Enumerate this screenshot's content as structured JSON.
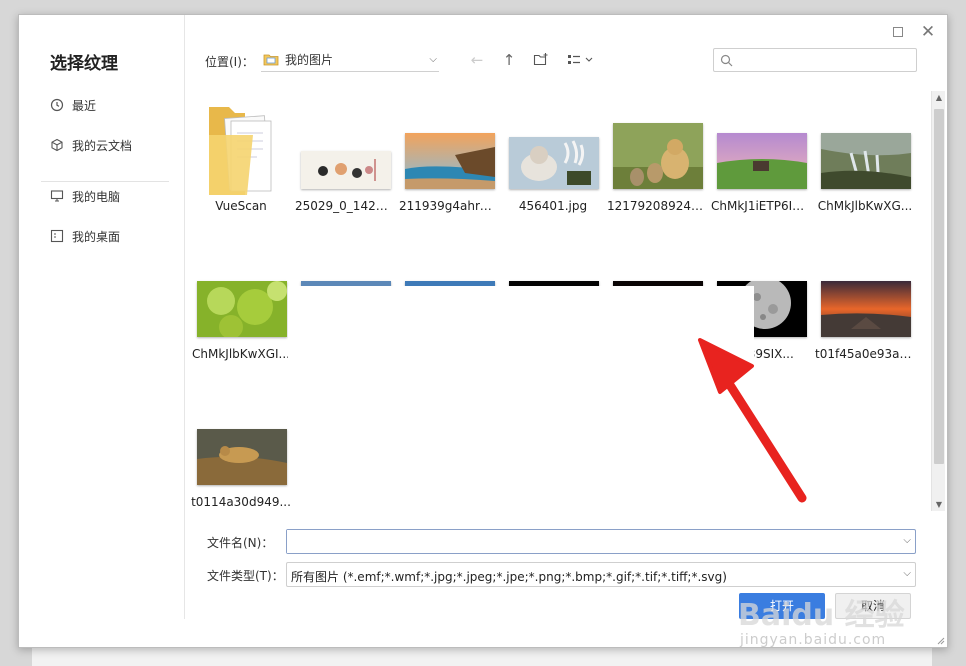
{
  "dialog": {
    "title": "选择纹理"
  },
  "sidebar": {
    "items": [
      {
        "label": "最近",
        "icon": "clock-icon"
      },
      {
        "label": "我的云文档",
        "icon": "cube-icon"
      },
      {
        "label": "我的电脑",
        "icon": "monitor-icon"
      },
      {
        "label": "我的桌面",
        "icon": "desktop-icon"
      }
    ]
  },
  "toolbar": {
    "location_label": "位置(I)：",
    "location_value": "我的图片"
  },
  "search": {
    "placeholder": ""
  },
  "files": [
    {
      "name": "VueScan",
      "type": "folder"
    },
    {
      "name": "25029_0_14275...",
      "type": "image"
    },
    {
      "name": "211939g4ahrm...",
      "type": "image"
    },
    {
      "name": "456401.jpg",
      "type": "image"
    },
    {
      "name": "121792089243...",
      "type": "image"
    },
    {
      "name": "ChMkJ1iETP6IG...",
      "type": "image"
    },
    {
      "name": "ChMkJlbKwXG...",
      "type": "image"
    },
    {
      "name": "ChMkJlbKwXGI...",
      "type": "image"
    },
    {
      "name": "12f39SIX...",
      "type": "image"
    },
    {
      "name": "t01f45a0e93a8...",
      "type": "image"
    },
    {
      "name": "t0114a30d949...",
      "type": "image"
    }
  ],
  "form": {
    "filename_label": "文件名(N)：",
    "filename_value": "",
    "filetype_label": "文件类型(T)：",
    "filetype_value": "所有图片 (*.emf;*.wmf;*.jpg;*.jpeg;*.jpe;*.png;*.bmp;*.gif;*.tif;*.tiff;*.svg)"
  },
  "buttons": {
    "open": "打开",
    "cancel": "取消"
  },
  "watermark": {
    "logo": "Baidu 经验",
    "url": "jingyan.baidu.com"
  },
  "colors": {
    "accent": "#3a7de0",
    "arrow": "#e8231f"
  }
}
